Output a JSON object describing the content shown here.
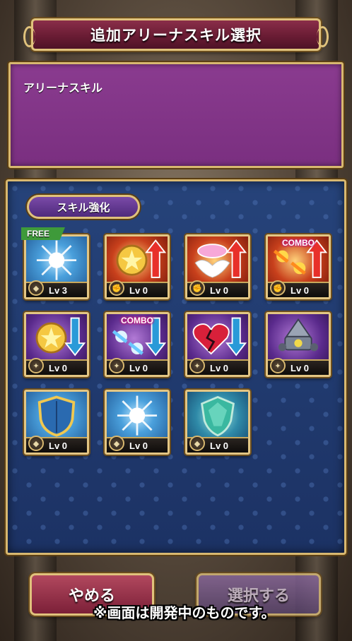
{
  "header": {
    "title": "追加アリーナスキル選択"
  },
  "description": {
    "title": "アリーナスキル"
  },
  "section": {
    "tab_label": "スキル強化"
  },
  "skills": [
    {
      "name": "light-burst",
      "level": "Lv 3",
      "tag": "FREE",
      "combo": "",
      "theme": "blue",
      "badge": "shield"
    },
    {
      "name": "star-medal-up",
      "level": "Lv 0",
      "tag": "",
      "combo": "",
      "theme": "red",
      "badge": "arm"
    },
    {
      "name": "wing-swirl-up",
      "level": "Lv 0",
      "tag": "",
      "combo": "",
      "theme": "red",
      "badge": "arm"
    },
    {
      "name": "combo-fire-up",
      "level": "Lv 0",
      "tag": "",
      "combo": "COMBO",
      "theme": "red",
      "badge": "arm"
    },
    {
      "name": "star-medal-down",
      "level": "Lv 0",
      "tag": "",
      "combo": "",
      "theme": "purple",
      "badge": "sparkle"
    },
    {
      "name": "combo-ice-down",
      "level": "Lv 0",
      "tag": "",
      "combo": "COMBO",
      "theme": "purple",
      "badge": "sparkle"
    },
    {
      "name": "broken-heart-down",
      "level": "Lv 0",
      "tag": "",
      "combo": "",
      "theme": "purple",
      "badge": "sparkle"
    },
    {
      "name": "mecha-drone",
      "level": "Lv 0",
      "tag": "",
      "combo": "",
      "theme": "purple",
      "badge": "sparkle"
    },
    {
      "name": "shield",
      "level": "Lv 0",
      "tag": "",
      "combo": "",
      "theme": "blue",
      "badge": "shield"
    },
    {
      "name": "light-burst-2",
      "level": "Lv 0",
      "tag": "",
      "combo": "",
      "theme": "blue",
      "badge": "shield"
    },
    {
      "name": "emerald-shield",
      "level": "Lv 0",
      "tag": "",
      "combo": "",
      "theme": "teal",
      "badge": "shield"
    }
  ],
  "buttons": {
    "cancel": "やめる",
    "select": "選択する"
  },
  "footnote": "※画面は開発中のものです。"
}
